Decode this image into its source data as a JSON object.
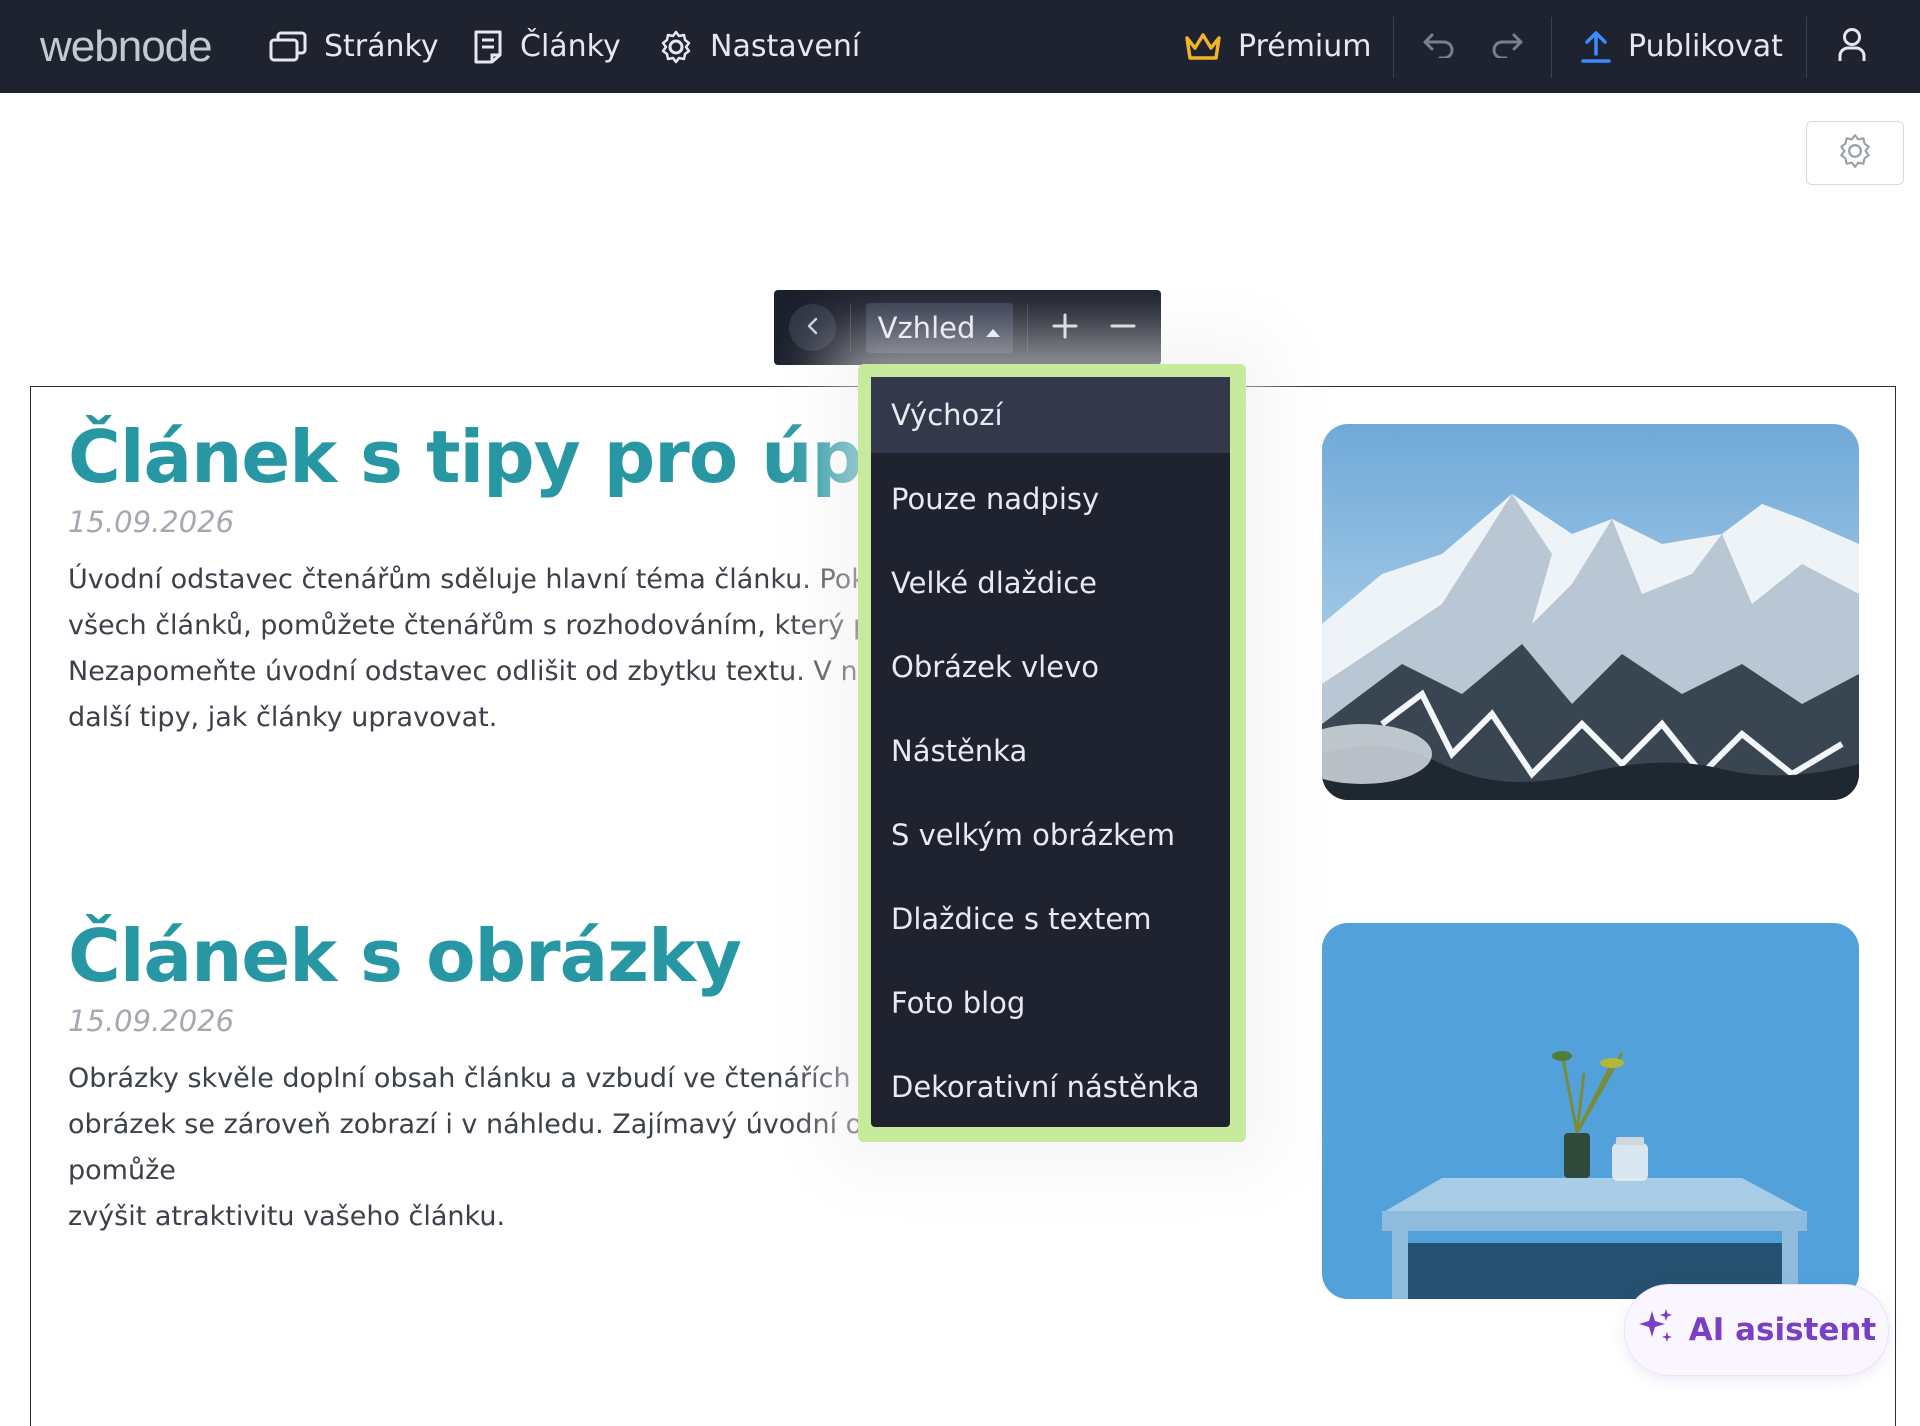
{
  "topbar": {
    "logo": "webnode",
    "nav": [
      {
        "label": "Stránky",
        "icon": "pages-icon"
      },
      {
        "label": "Články",
        "icon": "articles-icon"
      },
      {
        "label": "Nastavení",
        "icon": "gear-icon"
      }
    ],
    "premium_label": "Prémium",
    "publish_label": "Publikovat",
    "accent_gold": "#f0b429",
    "accent_blue": "#3d8bfd"
  },
  "toolbar": {
    "appearance_label": "Vzhled",
    "plus_symbol": "+",
    "minus_symbol": "–"
  },
  "layout_menu": {
    "selected": "Výchozí",
    "items": [
      "Výchozí",
      "Pouze nadpisy",
      "Velké dlaždice",
      "Obrázek vlevo",
      "Nástěnka",
      "S velkým obrázkem",
      "Dlaždice s textem",
      "Foto blog",
      "Dekorativní nástěnka"
    ],
    "highlight_color": "#c7ea9c"
  },
  "articles": [
    {
      "title": "Článek s tipy pro úpravu",
      "date": "15.09.2026",
      "lines": [
        "Úvodní odstavec čtenářům sděluje hlavní téma článku. Pok",
        "všech článků, pomůžete čtenářům s rozhodováním, který p",
        "Nezapomeňte úvodní odstavec odlišit od zbytku textu. V n",
        "další tipy, jak články upravovat."
      ],
      "image": "mountain-image"
    },
    {
      "title": "Článek s obrázky",
      "date": "15.09.2026",
      "lines": [
        "Obrázky skvěle doplní obsah článku a vzbudí ve čtenářích",
        "obrázek se zároveň zobrazí i v náhledu. Zajímavý úvodní obrázek vám tak pomůže",
        "zvýšit atraktivitu vašeho článku."
      ],
      "image": "table-vase-image"
    }
  ],
  "ai_assistant": {
    "label": "AI asistent",
    "color": "#7a3fc4"
  },
  "title_color": "#2797a3"
}
